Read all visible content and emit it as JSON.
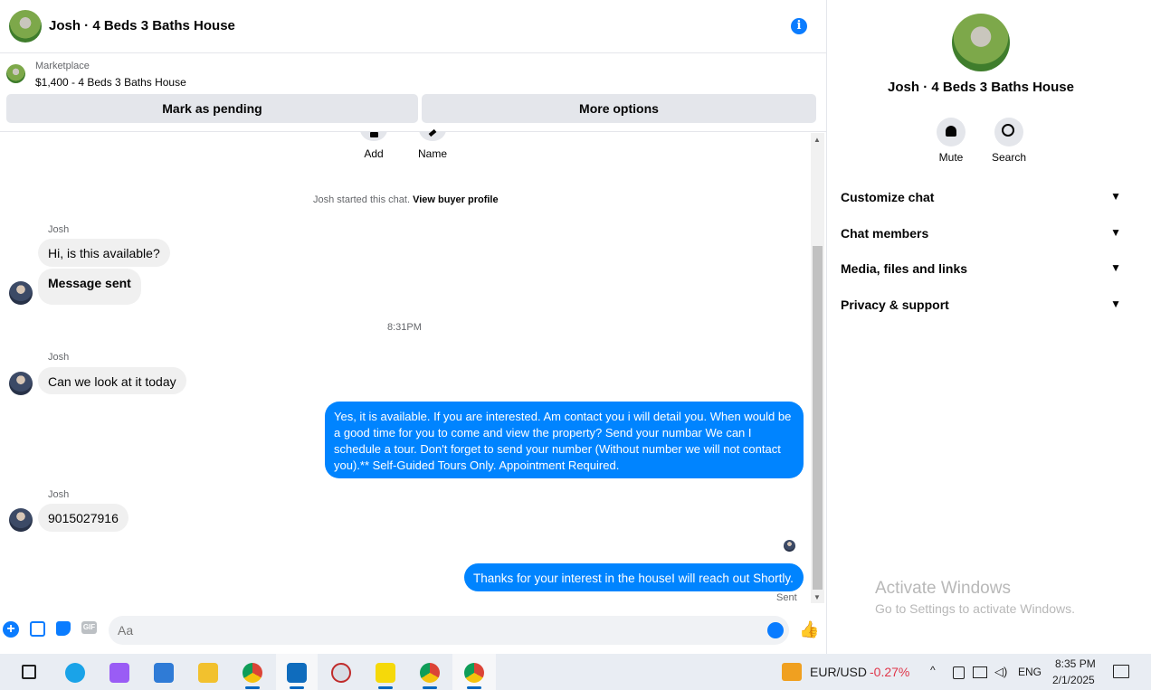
{
  "chat_header": {
    "title": "Josh · 4 Beds 3 Baths House",
    "info_icon": "info-icon"
  },
  "marketplace": {
    "label": "Marketplace",
    "listing": "$1,400 - 4 Beds 3 Baths House"
  },
  "actions": {
    "mark_pending": "Mark as pending",
    "more_options": "More options"
  },
  "top_actions": {
    "add": "Add",
    "name": "Name"
  },
  "system": {
    "started": "Josh started this chat.",
    "view_profile": "View buyer profile",
    "timestamp": "8:31PM"
  },
  "messages": [
    {
      "sender": "Josh",
      "text": "Hi, is this available?"
    },
    {
      "text": "Message sent"
    },
    {
      "sender": "Josh",
      "text": "Can we look at it today"
    },
    {
      "text": "Yes, it is available. If you are interested.  Am contact you i will detail you.  When would be a good time for you to come and view the property? Send your numbar We can I schedule a tour.  Don't forget to send your number (Without number we will not contact you).** Self-Guided Tours Only. Appointment Required."
    },
    {
      "sender": "Josh",
      "text": "9015027916"
    },
    {
      "text": "Thanks for your interest in the houseI will reach out Shortly."
    }
  ],
  "sent_status": "Sent",
  "composer": {
    "placeholder": "Aa"
  },
  "right_panel": {
    "title": "Josh · 4 Beds 3 Baths House",
    "mute": "Mute",
    "search": "Search",
    "sections": [
      "Customize chat",
      "Chat members",
      "Media, files and links",
      "Privacy & support"
    ]
  },
  "watermark": {
    "title": "Activate Windows",
    "subtitle": "Go to Settings to activate Windows."
  },
  "taskbar": {
    "ticker_label": "EUR/USD",
    "ticker_value": "-0.27%",
    "language": "ENG",
    "time": "8:35 PM",
    "date": "2/1/2025"
  },
  "colors": {
    "accent": "#0084ff",
    "ticker_negative": "#e0364a"
  }
}
